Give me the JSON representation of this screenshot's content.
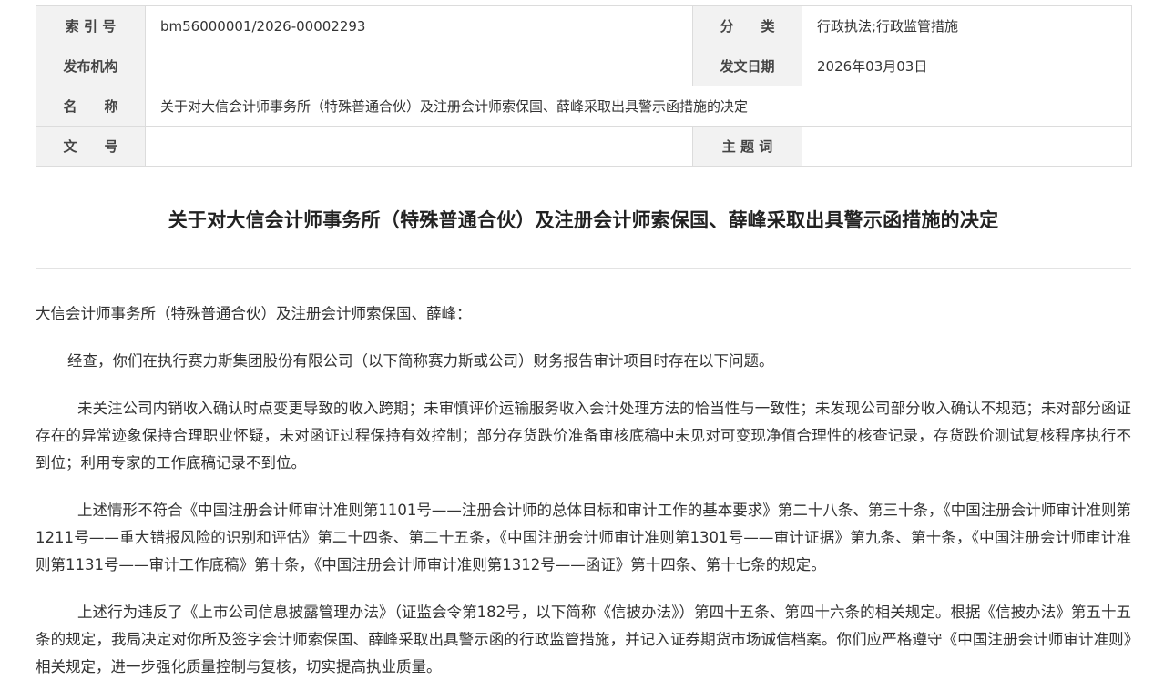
{
  "meta": {
    "index_label": "索 引 号",
    "index_value": "bm56000001/2026-00002293",
    "category_label": "分　　类",
    "category_value": "行政执法;行政监管措施",
    "publisher_label": "发布机构",
    "publisher_value": "",
    "date_label": "发文日期",
    "date_value": "2026年03月03日",
    "name_label": "名　　称",
    "name_value": "关于对大信会计师事务所（特殊普通合伙）及注册会计师索保国、薛峰采取出具警示函措施的决定",
    "docno_label": "文　　号",
    "docno_value": "",
    "subject_label": "主 题 词",
    "subject_value": ""
  },
  "title": "关于对大信会计师事务所（特殊普通合伙）及注册会计师索保国、薛峰采取出具警示函措施的决定",
  "body": {
    "greeting": "大信会计师事务所（特殊普通合伙）及注册会计师索保国、薛峰：",
    "p1": "经查，你们在执行赛力斯集团股份有限公司（以下简称赛力斯或公司）财务报告审计项目时存在以下问题。",
    "p2": "未关注公司内销收入确认时点变更导致的收入跨期；未审慎评价运输服务收入会计处理方法的恰当性与一致性；未发现公司部分收入确认不规范；未对部分函证存在的异常迹象保持合理职业怀疑，未对函证过程保持有效控制；部分存货跌价准备审核底稿中未见对可变现净值合理性的核查记录，存货跌价测试复核程序执行不到位；利用专家的工作底稿记录不到位。",
    "p3": "上述情形不符合《中国注册会计师审计准则第1101号——注册会计师的总体目标和审计工作的基本要求》第二十八条、第三十条，《中国注册会计师审计准则第1211号——重大错报风险的识别和评估》第二十四条、第二十五条，《中国注册会计师审计准则第1301号——审计证据》第九条、第十条，《中国注册会计师审计准则第1131号——审计工作底稿》第十条，《中国注册会计师审计准则第1312号——函证》第十四条、第十七条的规定。",
    "p4": "上述行为违反了《上市公司信息披露管理办法》（证监会令第182号，以下简称《信披办法》）第四十五条、第四十六条的相关规定。根据《信披办法》第五十五条的规定，我局决定对你所及签字会计师索保国、薛峰采取出具警示函的行政监管措施，并记入证券期货市场诚信档案。你们应严格遵守《中国注册会计师审计准则》相关规定，进一步强化质量控制与复核，切实提高执业质量。"
  }
}
